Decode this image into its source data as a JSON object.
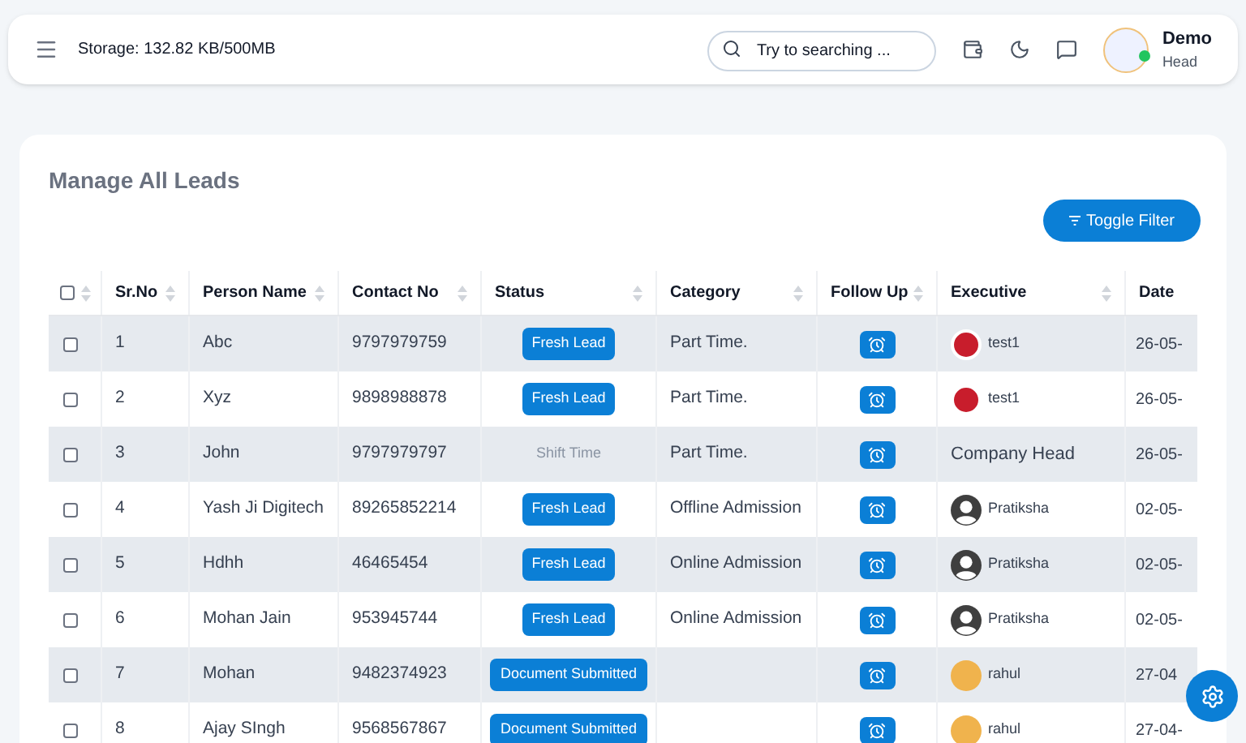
{
  "topbar": {
    "storage": "Storage: 132.82 KB/500MB",
    "search": {
      "placeholder": "Try to searching ..."
    },
    "user": {
      "name": "Demo",
      "role": "Head",
      "online": true
    }
  },
  "page": {
    "title": "Manage All Leads",
    "toggle_filter": "Toggle Filter"
  },
  "table": {
    "select_all": {
      "checked": false
    },
    "columns": [
      "Sr.No",
      "Person Name",
      "Contact No",
      "Status",
      "Category",
      "Follow Up",
      "Executive",
      "Date"
    ],
    "rows": [
      {
        "checked": false,
        "sr": "1",
        "name": "Abc",
        "contact": "9797979759",
        "status": {
          "kind": "badge",
          "text": "Fresh Lead"
        },
        "category": "Part Time.",
        "executive": {
          "kind": "picture",
          "text": "test1"
        },
        "date": "26-05-"
      },
      {
        "checked": false,
        "sr": "2",
        "name": "Xyz",
        "contact": "9898988878",
        "status": {
          "kind": "badge",
          "text": "Fresh Lead"
        },
        "category": "Part Time.",
        "executive": {
          "kind": "picture",
          "text": "test1"
        },
        "date": "26-05-"
      },
      {
        "checked": false,
        "sr": "3",
        "name": "John",
        "contact": "9797979797",
        "status": {
          "kind": "faint",
          "text": "Shift Time"
        },
        "category": "Part Time.",
        "executive": {
          "kind": "text",
          "text": "Company Head"
        },
        "date": "26-05-"
      },
      {
        "checked": false,
        "sr": "4",
        "name": "Yash Ji Digitech",
        "contact": "89265852214",
        "status": {
          "kind": "badge",
          "text": "Fresh Lead"
        },
        "category": "Offline Admission",
        "executive": {
          "kind": "silhouette",
          "text": "Pratiksha"
        },
        "date": "02-05-"
      },
      {
        "checked": false,
        "sr": "5",
        "name": "Hdhh",
        "contact": "46465454",
        "status": {
          "kind": "badge",
          "text": "Fresh Lead"
        },
        "category": "Online Admission",
        "executive": {
          "kind": "silhouette",
          "text": "Pratiksha"
        },
        "date": "02-05-"
      },
      {
        "checked": false,
        "sr": "6",
        "name": "Mohan Jain",
        "contact": "953945744",
        "status": {
          "kind": "badge",
          "text": "Fresh Lead"
        },
        "category": "Online Admission",
        "executive": {
          "kind": "silhouette",
          "text": "Pratiksha"
        },
        "date": "02-05-"
      },
      {
        "checked": false,
        "sr": "7",
        "name": "Mohan",
        "contact": "9482374923",
        "status": {
          "kind": "badge",
          "text": "Document Submitted"
        },
        "category": "",
        "executive": {
          "kind": "photo",
          "text": "rahul"
        },
        "date": "27-04"
      },
      {
        "checked": false,
        "sr": "8",
        "name": "Ajay SIngh",
        "contact": "9568567867",
        "status": {
          "kind": "badge",
          "text": "Document Submitted"
        },
        "category": "",
        "executive": {
          "kind": "photo",
          "text": "rahul"
        },
        "date": "27-04-"
      }
    ]
  }
}
